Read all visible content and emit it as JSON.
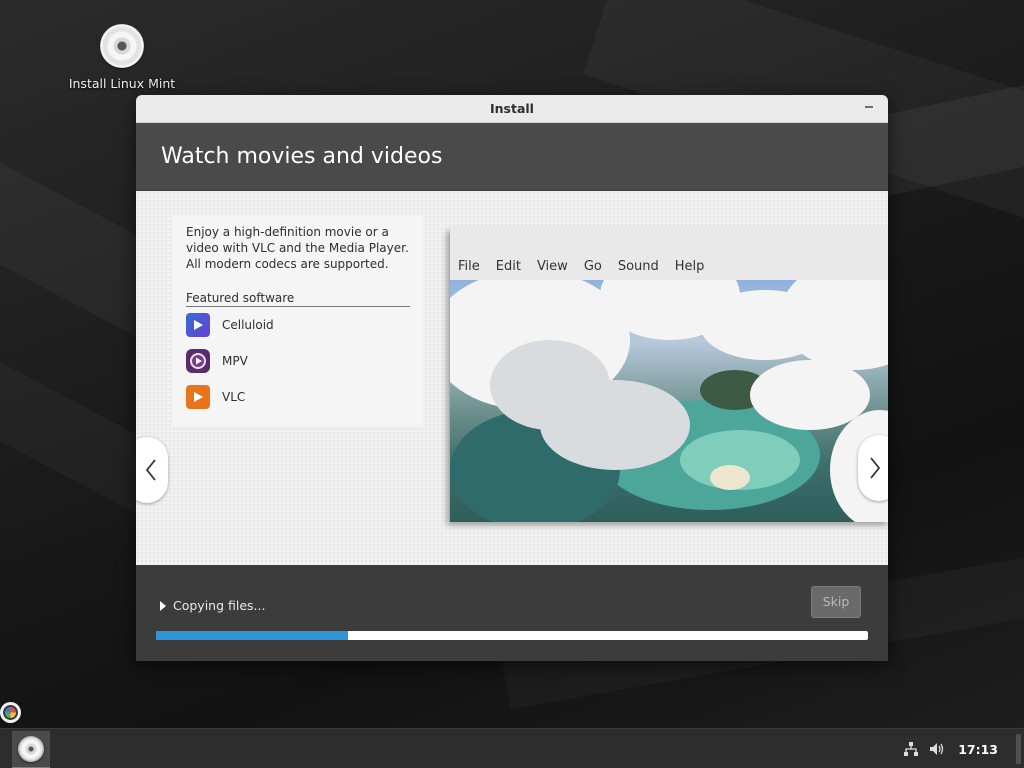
{
  "desktop": {
    "icon_label": "Install Linux Mint"
  },
  "window": {
    "title": "Install",
    "heading": "Watch movies and videos",
    "slide": {
      "description": "Enjoy a high-definition movie or a video with VLC and the Media Player. All modern codecs are supported.",
      "featured_title": "Featured software",
      "software": [
        {
          "name": "Celluloid",
          "icon": "celluloid-icon"
        },
        {
          "name": "MPV",
          "icon": "mpv-icon"
        },
        {
          "name": "VLC",
          "icon": "vlc-icon"
        }
      ],
      "player_menu": [
        "File",
        "Edit",
        "View",
        "Go",
        "Sound",
        "Help"
      ]
    },
    "status": "Copying files...",
    "skip_label": "Skip",
    "progress_fraction": 0.27
  },
  "taskbar": {
    "clock": "17:13"
  },
  "colors": {
    "accent": "#2e97d8",
    "header_band": "#4a4a4a",
    "window_bg": "#3c3c3c"
  }
}
